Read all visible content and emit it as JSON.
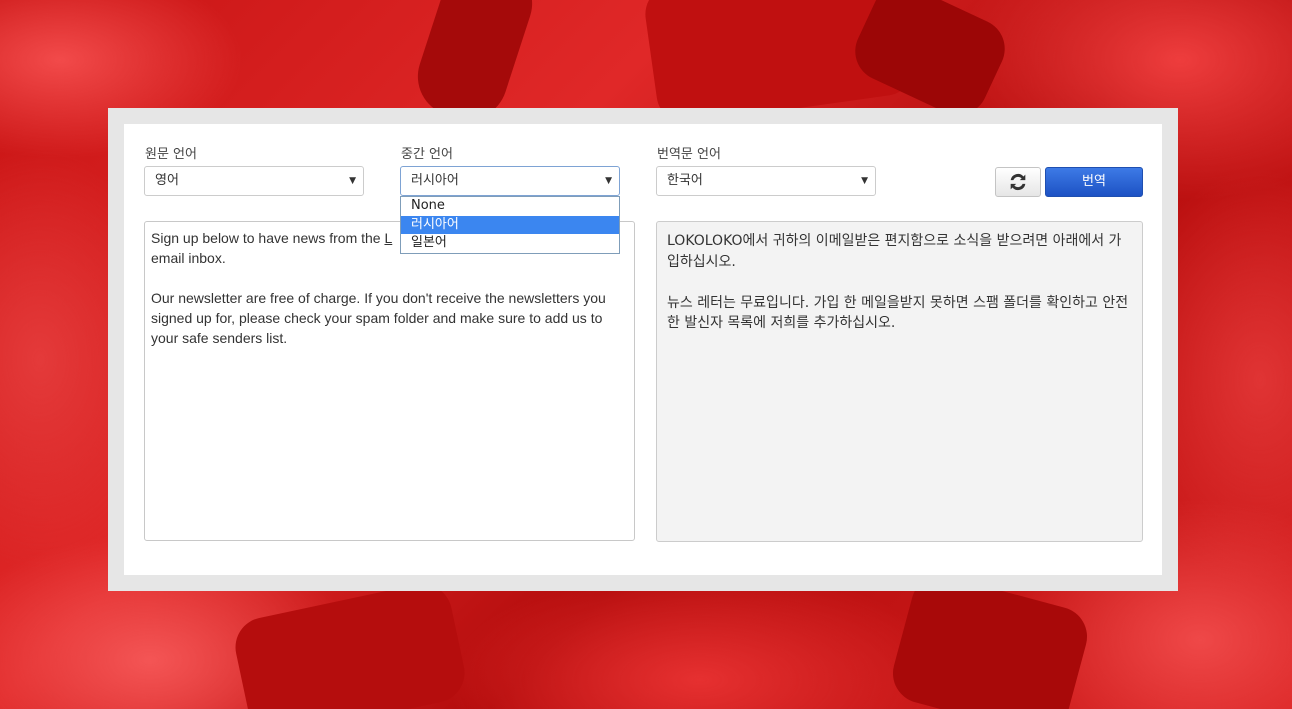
{
  "source_language": {
    "label": "원문 언어",
    "selected": "영어"
  },
  "intermediate_language": {
    "label": "중간 언어",
    "selected": "러시아어",
    "options": [
      "None",
      "러시아어",
      "일본어"
    ]
  },
  "target_language": {
    "label": "번역문 언어",
    "selected": "한국어"
  },
  "buttons": {
    "translate_label": "번역"
  },
  "source_text": {
    "line1_before": "Sign up below to have news from the ",
    "line1_hidden": "L",
    "rest": "email inbox.\n\nOur newsletter are free of charge. If you don't receive the newsletters you signed up for, please check your spam folder and make sure to add us to your safe senders list."
  },
  "output_text": "LOKOLOKO에서 귀하의 이메일받은 편지함으로 소식을 받으려면 아래에서 가입하십시오.\n\n뉴스 레터는 무료입니다. 가입 한 메일을받지 못하면 스팸 폴더를 확인하고 안전한 발신자 목록에 저희를 추가하십시오.",
  "colors": {
    "accent": "#1d52c4",
    "selected_option": "#3b86f0",
    "background": "#d82020"
  },
  "icons": {
    "swap": "swap-arrows-icon",
    "dropdown_arrow": "caret-down-icon"
  }
}
